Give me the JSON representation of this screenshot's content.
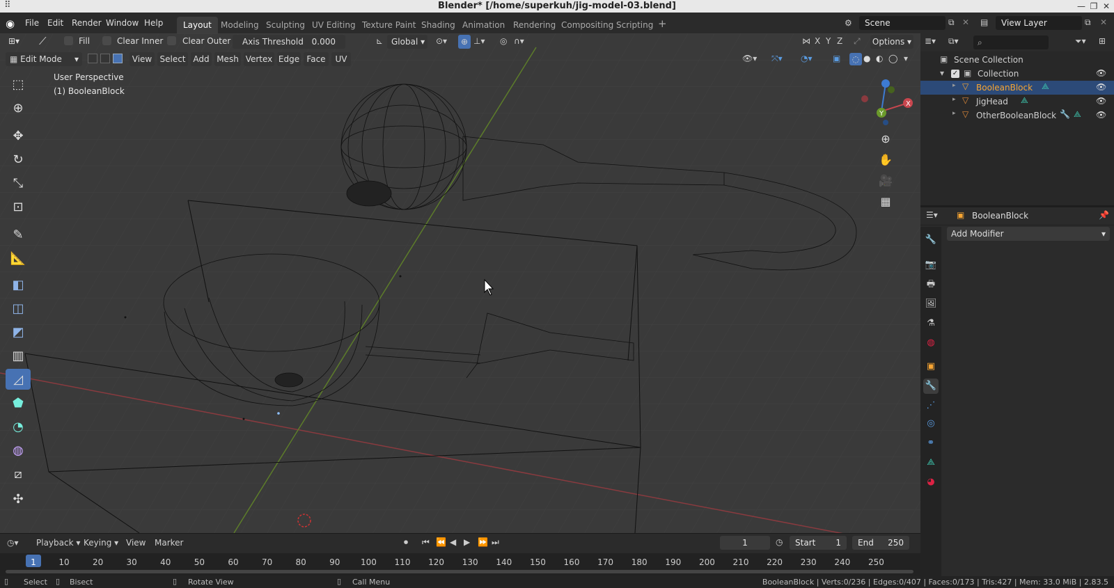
{
  "window": {
    "title": "Blender* [/home/superkuh/jig-model-03.blend]"
  },
  "menu": [
    "File",
    "Edit",
    "Render",
    "Window",
    "Help"
  ],
  "workspaces": [
    "Layout",
    "Modeling",
    "Sculpting",
    "UV Editing",
    "Texture Paint",
    "Shading",
    "Animation",
    "Rendering",
    "Compositing",
    "Scripting"
  ],
  "active_workspace": "Layout",
  "scene": {
    "name": "Scene",
    "view_layer": "View Layer"
  },
  "tool_header": {
    "fill": "Fill",
    "clear_inner": "Clear Inner",
    "clear_outer": "Clear Outer",
    "axis_threshold_label": "Axis Threshold",
    "axis_threshold_value": "0.000",
    "transform_orientation": "Global",
    "options": "Options",
    "axis_x": "X",
    "axis_y": "Y",
    "axis_z": "Z"
  },
  "viewport_header": {
    "mode": "Edit Mode",
    "menus": [
      "View",
      "Select",
      "Add",
      "Mesh",
      "Vertex",
      "Edge",
      "Face",
      "UV"
    ]
  },
  "viewport": {
    "perspective": "User Perspective",
    "object_label": "(1) BooleanBlock"
  },
  "outliner": {
    "scene_collection": "Scene Collection",
    "collection": "Collection",
    "items": [
      "BooleanBlock",
      "JigHead",
      "OtherBooleanBlock"
    ],
    "selected": "BooleanBlock",
    "search_placeholder": ""
  },
  "properties": {
    "object_name": "BooleanBlock",
    "add_modifier": "Add Modifier"
  },
  "timeline": {
    "menus": [
      "Playback",
      "Keying",
      "View",
      "Marker"
    ],
    "current_frame": "1",
    "start_label": "Start",
    "start": "1",
    "end_label": "End",
    "end": "250",
    "ticks": [
      "1",
      "10",
      "20",
      "30",
      "40",
      "50",
      "60",
      "70",
      "80",
      "90",
      "100",
      "110",
      "120",
      "130",
      "140",
      "150",
      "160",
      "170",
      "180",
      "190",
      "200",
      "210",
      "220",
      "230",
      "240",
      "250"
    ]
  },
  "statusbar": {
    "select": "Select",
    "bisect": "Bisect",
    "rotate_view": "Rotate View",
    "call_menu": "Call Menu",
    "stats": "BooleanBlock | Verts:0/236 | Edges:0/407 | Faces:0/173 | Tris:427 | Mem: 33.0 MiB | 2.83.5"
  },
  "colors": {
    "accent": "#4772b3",
    "selected_text": "#f7a533",
    "x_axis": "#c8464e",
    "y_axis": "#6b9a2b",
    "z_axis": "#3d7bd1"
  }
}
